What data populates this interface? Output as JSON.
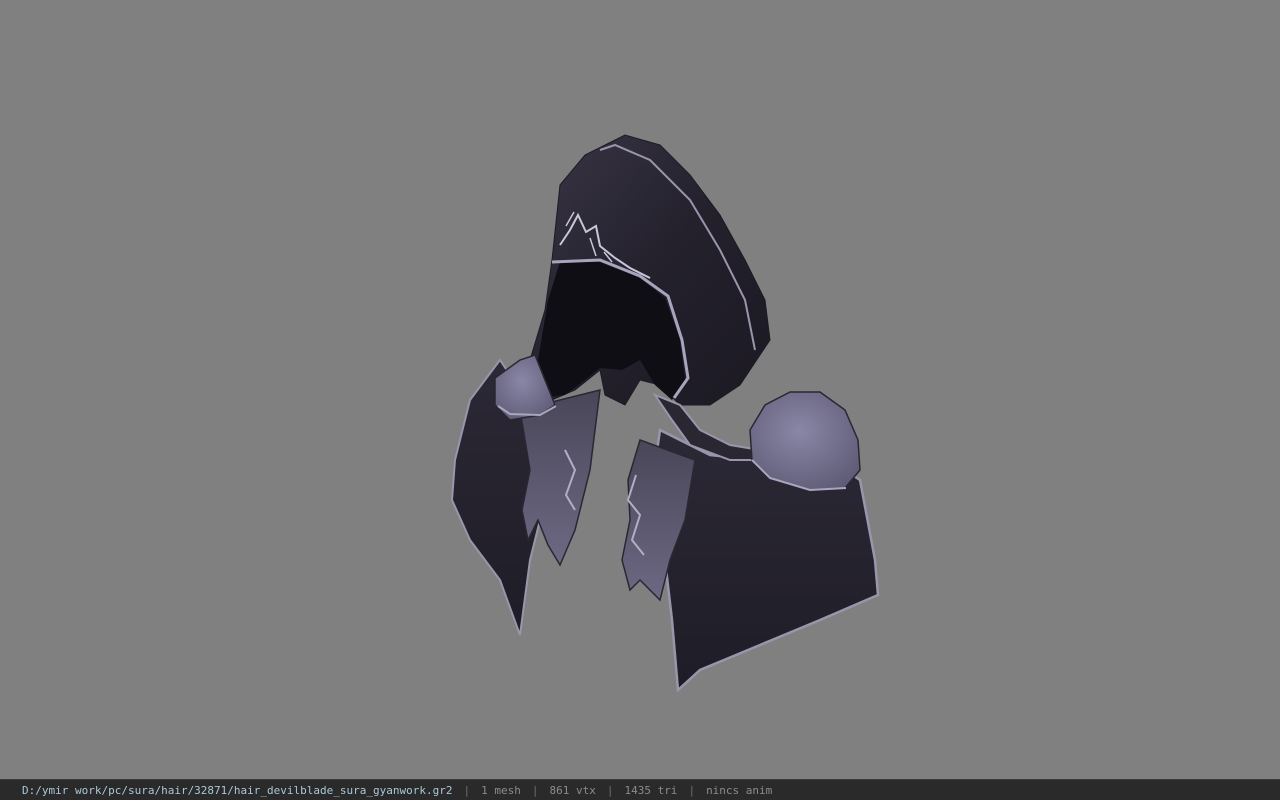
{
  "viewer": {
    "background_color": "#808080",
    "model_name": "hood-mesh-icon"
  },
  "status": {
    "path": "D:/ymir work/pc/sura/hair/32871/hair_devilblade_sura_gyanwork.gr2",
    "sep": "|",
    "mesh": "1 mesh",
    "vtx": "861 vtx",
    "tri": "1435 tri",
    "anim": "nincs anim"
  }
}
